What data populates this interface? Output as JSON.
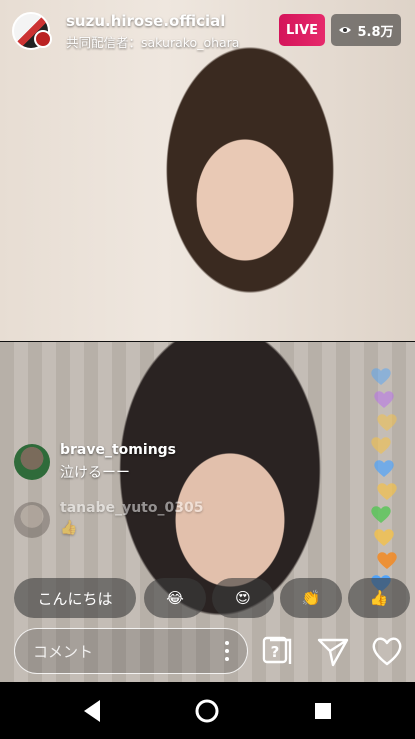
{
  "header": {
    "username": "suzu.hirose.official",
    "cohost_label": "共同配信者：sakurako_ohara",
    "live_label": "LIVE",
    "viewer_count": "5.8万"
  },
  "comments": [
    {
      "user": "brave_tomings",
      "text": "泣けるーー"
    },
    {
      "user": "tanabe_yuto_0305",
      "text": "👍"
    }
  ],
  "quick_reactions": [
    "こんにちは",
    "😂",
    "😍",
    "👏",
    "👍"
  ],
  "comment_input": {
    "placeholder": "コメント"
  },
  "icons": {
    "question": "question-box-icon",
    "send": "paper-plane-icon",
    "like": "heart-outline-icon"
  },
  "floating_hearts": [
    "#4aa3ff",
    "#b86bf0",
    "#f2c14e",
    "#f2c14e",
    "#4aa3ff",
    "#f2c14e",
    "#53c653",
    "#f2c14e",
    "#f28c28",
    "#4aa3ff"
  ],
  "colors": {
    "live": "#d4145a"
  }
}
